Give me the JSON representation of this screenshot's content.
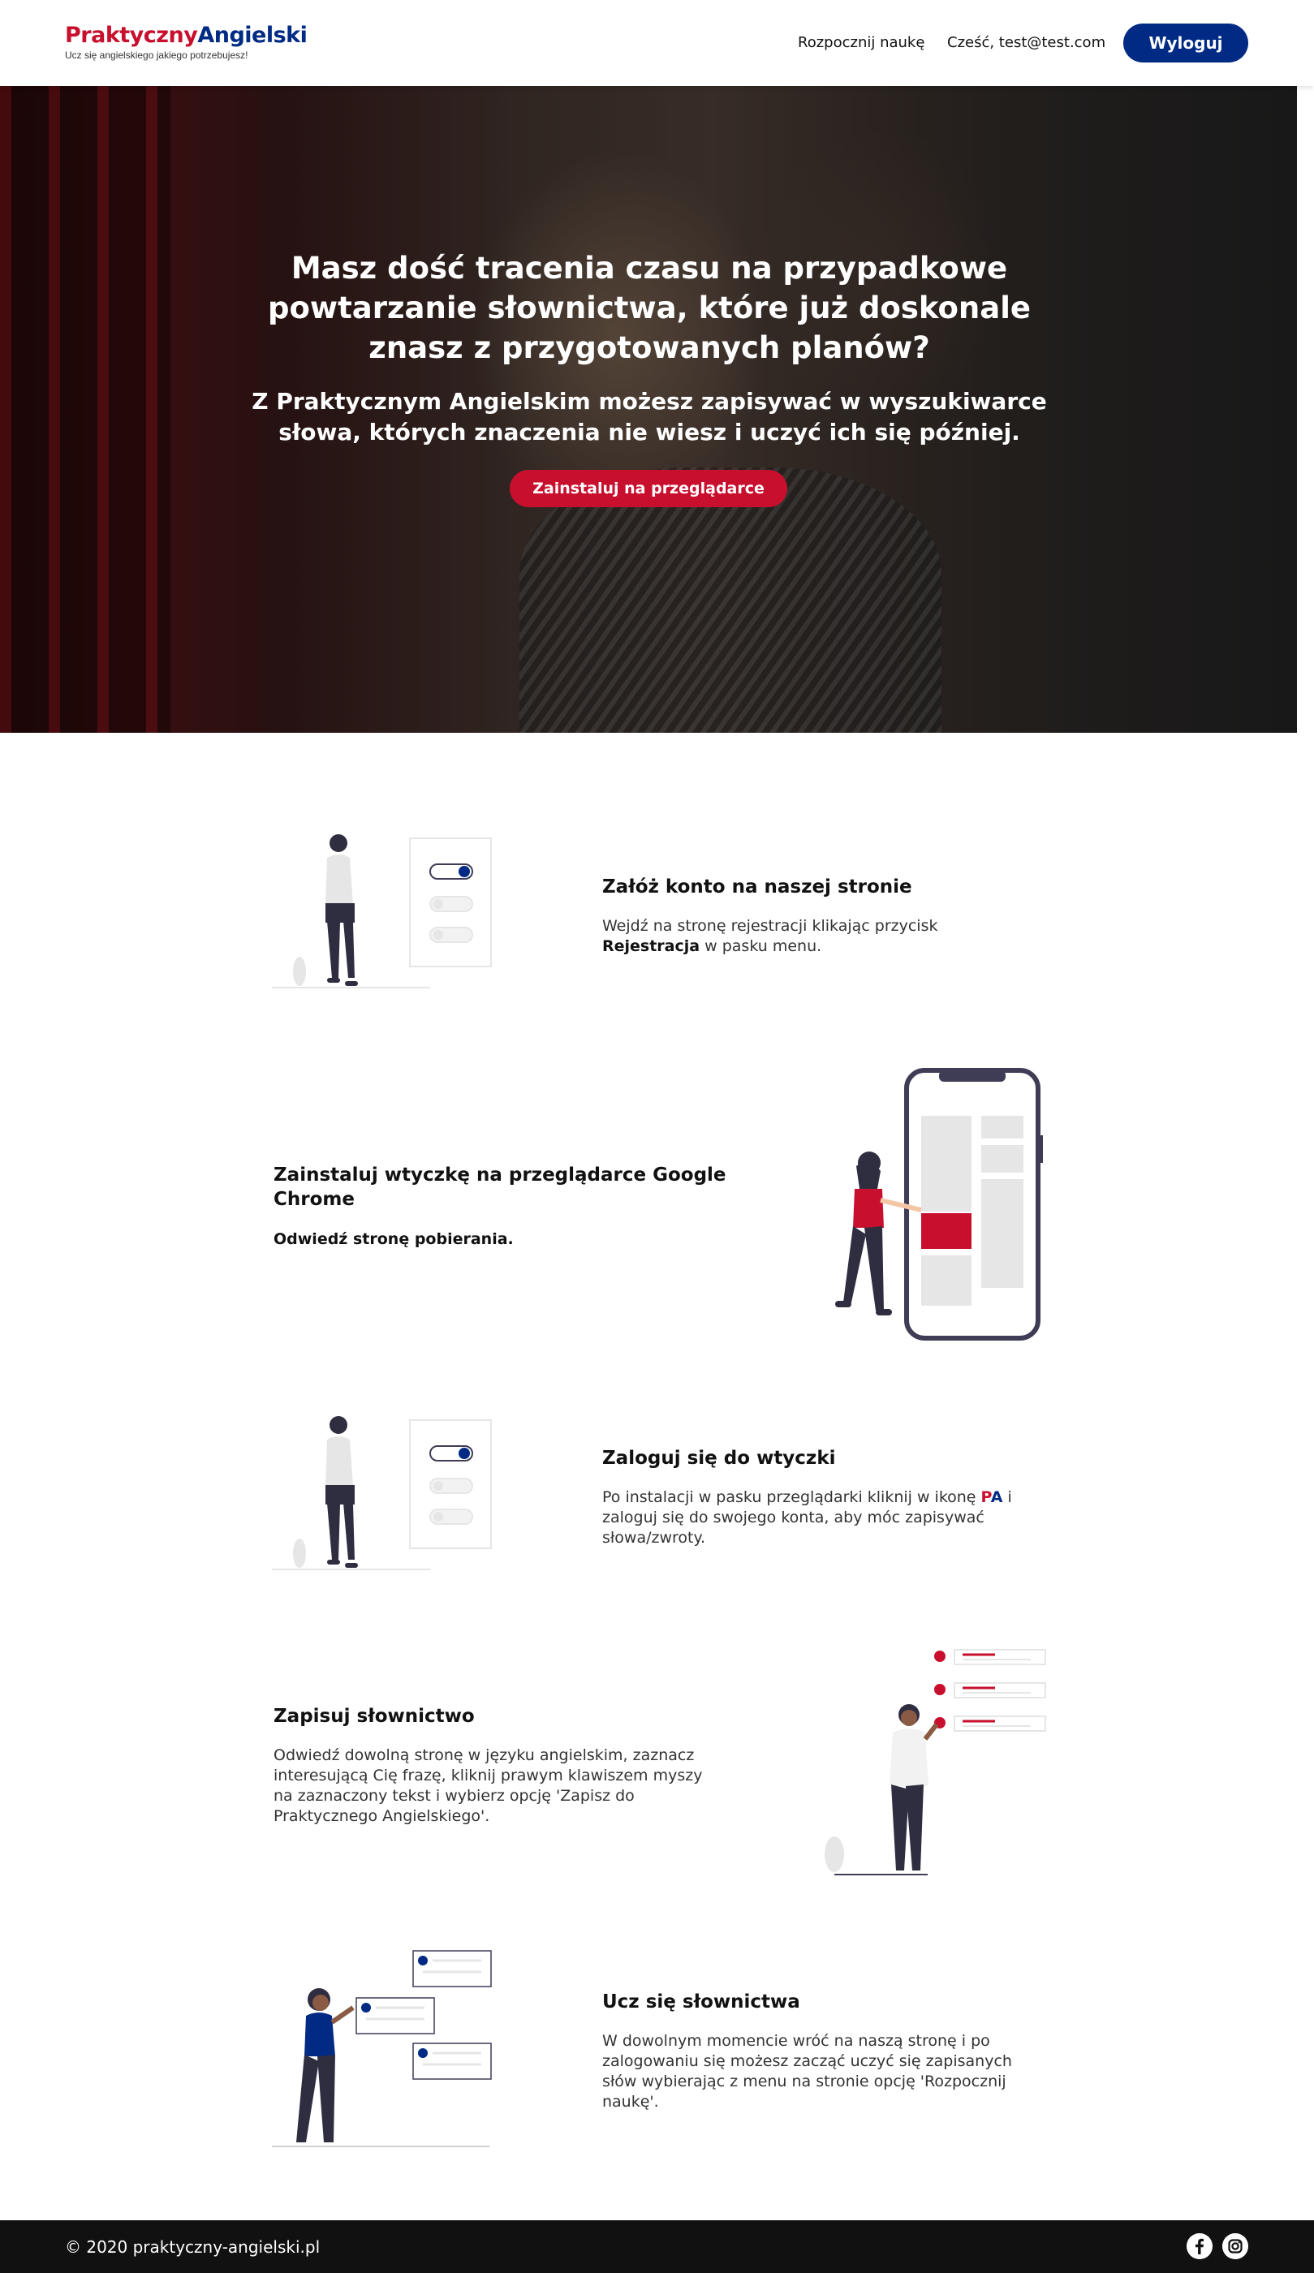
{
  "brand": {
    "name_part1": "Praktyczny",
    "name_part2": "Angielski",
    "tagline": "Ucz się angielskiego jakiego potrzebujesz!",
    "colors": {
      "red": "#c8102e",
      "blue": "#002a84"
    }
  },
  "nav": {
    "start_link": "Rozpocznij naukę",
    "greeting": "Cześć, test@test.com",
    "logout": "Wyloguj"
  },
  "hero": {
    "headline": "Masz dość tracenia czasu na przypadkowe powtarzanie słownictwa, które już doskonale znasz z przygotowanych planów?",
    "subheadline": "Z Praktycznym Angielskim możesz zapisywać w wyszukiwarce słowa, których znaczenia nie wiesz i uczyć ich się później.",
    "cta": "Zainstaluj na przeglądarce"
  },
  "steps": [
    {
      "title": "Załóż konto na naszej stronie",
      "text_before": "Wejdź na stronę rejestracji klikając przycisk ",
      "text_bold": "Rejestracja",
      "text_after": " w pasku menu."
    },
    {
      "title": "Zainstaluj wtyczkę na przeglądarce Google Chrome",
      "text_bold": "Odwiedź stronę pobierania."
    },
    {
      "title": "Zaloguj się do wtyczki",
      "text_before": "Po instalacji w pasku przeglądarki kliknij w ikonę ",
      "pa_p": "P",
      "pa_a": "A",
      "text_after": " i zaloguj się do swojego konta, aby móc zapisywać słowa/zwroty."
    },
    {
      "title": "Zapisuj słownictwo",
      "text": "Odwiedź dowolną stronę w języku angielskim, zaznacz interesującą Cię frazę, kliknij prawym klawiszem myszy na zaznaczony tekst i wybierz opcję 'Zapisz do Praktycznego Angielskiego'."
    },
    {
      "title": "Ucz się słownictwa",
      "text": "W dowolnym momencie wróć na naszą stronę i po zalogowaniu się możesz zacząć uczyć się zapisanych słów wybierając z menu na stronie opcję 'Rozpocznij naukę'."
    }
  ],
  "footer": {
    "copyright": "© 2020 praktyczny-angielski.pl",
    "icons": [
      "facebook-icon",
      "instagram-icon"
    ]
  }
}
